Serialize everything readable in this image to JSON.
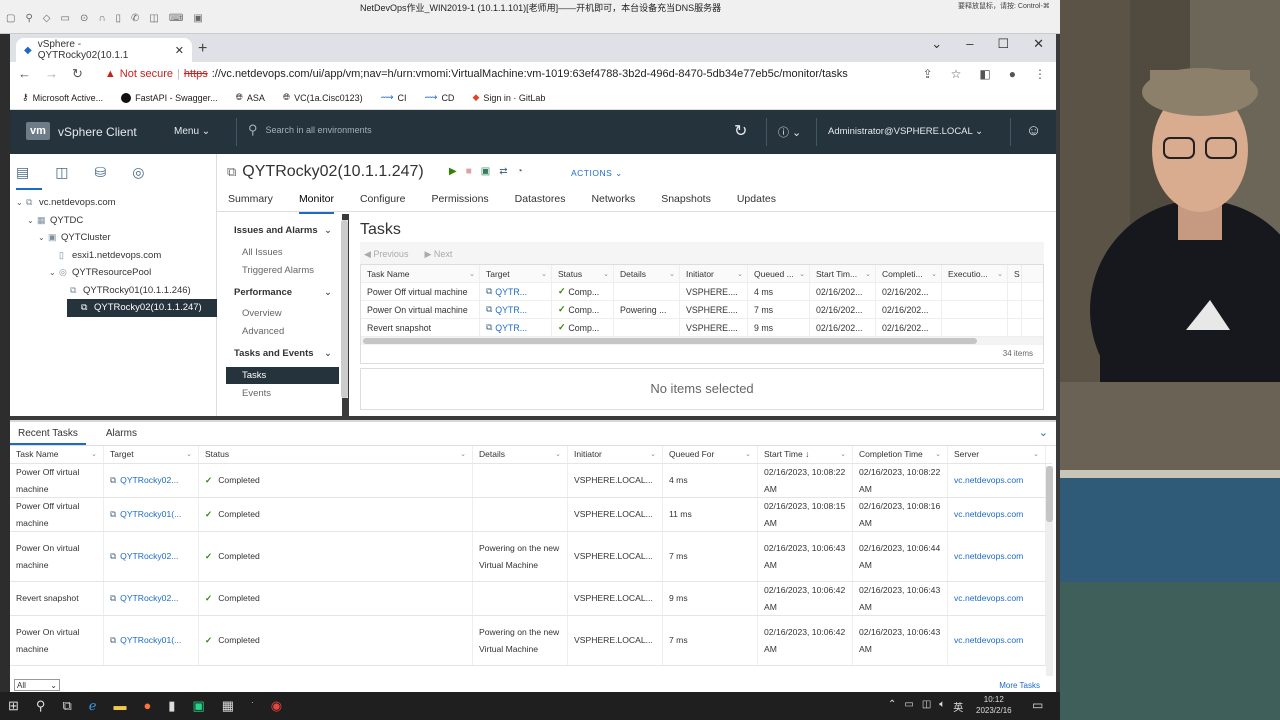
{
  "remote": {
    "title": "NetDevOps作业_WIN2019-1 (10.1.1.101)[老师用]——开机即可，本台设备充当DNS服务器",
    "hint": "要释放鼠标，请按: Control-⌘"
  },
  "browser": {
    "tab_title": "vSphere - QYTRocky02(10.1.1",
    "warning": "Not secure",
    "url_scheme": "https",
    "url_rest": "://vc.netdevops.com/ui/app/vm;nav=h/urn:vmomi:VirtualMachine:vm-1019:63ef4788-3b2d-496d-8470-5db34e77eb5c/monitor/tasks",
    "bookmarks": [
      "Microsoft Active...",
      "FastAPI - Swagger...",
      "ASA",
      "VC(1a.Cisc0123)",
      "CI",
      "CD",
      "Sign in · GitLab"
    ]
  },
  "vsphere": {
    "logo": "vm",
    "title": "vSphere Client",
    "menu": "Menu",
    "search_placeholder": "Search in all environments",
    "user": "Administrator@VSPHERE.LOCAL"
  },
  "tree": [
    {
      "label": "vc.netdevops.com",
      "level": 0,
      "arrow": "⌄",
      "icon": "⧉"
    },
    {
      "label": "QYTDC",
      "level": 1,
      "arrow": "⌄",
      "icon": "▦"
    },
    {
      "label": "QYTCluster",
      "level": 2,
      "arrow": "⌄",
      "icon": "▣"
    },
    {
      "label": "esxi1.netdevops.com",
      "level": 3,
      "arrow": "",
      "icon": "▯"
    },
    {
      "label": "QYTResourcePool",
      "level": 3,
      "arrow": "⌄",
      "icon": "◎"
    },
    {
      "label": "QYTRocky01(10.1.1.246)",
      "level": 4,
      "arrow": "",
      "icon": "⧉"
    },
    {
      "label": "QYTRocky02(10.1.1.247)",
      "level": 4,
      "arrow": "",
      "icon": "⧉",
      "selected": true
    }
  ],
  "object": {
    "title": "QYTRocky02(10.1.1.247)",
    "actions": "ACTIONS",
    "tabs": [
      "Summary",
      "Monitor",
      "Configure",
      "Permissions",
      "Datastores",
      "Networks",
      "Snapshots",
      "Updates"
    ],
    "active_tab": "Monitor"
  },
  "monitor_menu": {
    "issues": "Issues and Alarms",
    "all_issues": "All Issues",
    "triggered_alarms": "Triggered Alarms",
    "performance": "Performance",
    "overview": "Overview",
    "advanced": "Advanced",
    "tasks_events": "Tasks and Events",
    "tasks": "Tasks",
    "events": "Events"
  },
  "tasks_panel": {
    "heading": "Tasks",
    "previous": "Previous",
    "next": "Next",
    "columns": [
      "Task Name",
      "Target",
      "Status",
      "Details",
      "Initiator",
      "Queued ...",
      "Start Tim...",
      "Completi...",
      "Executio...",
      "S"
    ],
    "rows": [
      [
        "Power Off virtual machine",
        "QYTR...",
        "Comp...",
        "",
        "VSPHERE....",
        "4 ms",
        "02/16/202...",
        "02/16/202...",
        ""
      ],
      [
        "Power On virtual machine",
        "QYTR...",
        "Comp...",
        "Powering ...",
        "VSPHERE....",
        "7 ms",
        "02/16/202...",
        "02/16/202...",
        ""
      ],
      [
        "Revert snapshot",
        "QYTR...",
        "Comp...",
        "",
        "VSPHERE....",
        "9 ms",
        "02/16/202...",
        "02/16/202...",
        ""
      ]
    ],
    "count": "34 items",
    "no_selection": "No items selected"
  },
  "recent": {
    "tab_recent": "Recent Tasks",
    "tab_alarms": "Alarms",
    "columns": [
      "Task Name",
      "Target",
      "Status",
      "Details",
      "Initiator",
      "Queued For",
      "Start Time ↓",
      "Completion Time",
      "Server"
    ],
    "rows": [
      {
        "task": "Power Off virtual machine",
        "target": "QYTRocky02...",
        "status": "Completed",
        "details": "",
        "initiator": "VSPHERE.LOCAL...",
        "queued": "4 ms",
        "start": "02/16/2023, 10:08:22 AM",
        "completion": "02/16/2023, 10:08:22 AM",
        "server": "vc.netdevops.com"
      },
      {
        "task": "Power Off virtual machine",
        "target": "QYTRocky01(...",
        "status": "Completed",
        "details": "",
        "initiator": "VSPHERE.LOCAL...",
        "queued": "11 ms",
        "start": "02/16/2023, 10:08:15 AM",
        "completion": "02/16/2023, 10:08:16 AM",
        "server": "vc.netdevops.com"
      },
      {
        "task": "Power On virtual machine",
        "target": "QYTRocky02...",
        "status": "Completed",
        "details": "Powering on the new Virtual Machine",
        "initiator": "VSPHERE.LOCAL...",
        "queued": "7 ms",
        "start": "02/16/2023, 10:06:43 AM",
        "completion": "02/16/2023, 10:06:44 AM",
        "server": "vc.netdevops.com"
      },
      {
        "task": "Revert snapshot",
        "target": "QYTRocky02...",
        "status": "Completed",
        "details": "",
        "initiator": "VSPHERE.LOCAL...",
        "queued": "9 ms",
        "start": "02/16/2023, 10:06:42 AM",
        "completion": "02/16/2023, 10:06:43 AM",
        "server": "vc.netdevops.com"
      },
      {
        "task": "Power On virtual machine",
        "target": "QYTRocky01(...",
        "status": "Completed",
        "details": "Powering on the new Virtual Machine",
        "initiator": "VSPHERE.LOCAL...",
        "queued": "7 ms",
        "start": "02/16/2023, 10:06:42 AM",
        "completion": "02/16/2023, 10:06:43 AM",
        "server": "vc.netdevops.com"
      }
    ],
    "filter": "All",
    "more": "More Tasks"
  },
  "taskbar": {
    "ime": "英",
    "time": "10:12",
    "date": "2023/2/16"
  },
  "colors": {
    "header_bg": "#25333d",
    "accent": "#1b6ac9",
    "success": "#2f8400"
  }
}
